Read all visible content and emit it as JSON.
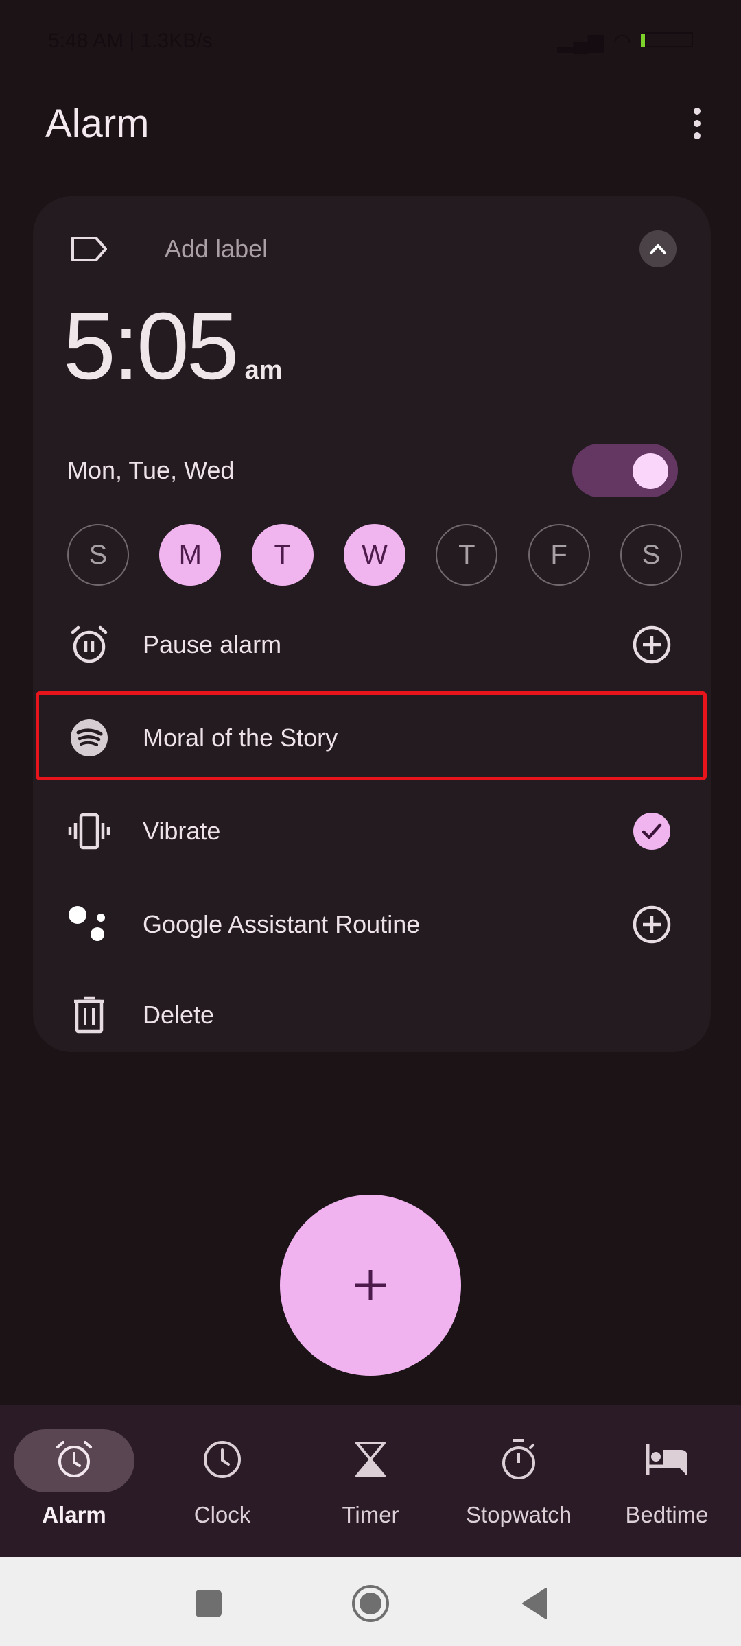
{
  "status_bar": {
    "time": "5:48 AM | 1.3KB/s"
  },
  "header": {
    "title": "Alarm",
    "more_icon": "more-vert-icon"
  },
  "alarm_card": {
    "label_placeholder": "Add label",
    "label_icon": "label-icon",
    "collapse_icon": "chevron-up-icon",
    "time": "5:05",
    "ampm": "am",
    "repeat_summary": "Mon, Tue, Wed",
    "enabled": true,
    "days": [
      {
        "letter": "S",
        "selected": false
      },
      {
        "letter": "M",
        "selected": true
      },
      {
        "letter": "T",
        "selected": true
      },
      {
        "letter": "W",
        "selected": true
      },
      {
        "letter": "T",
        "selected": false
      },
      {
        "letter": "F",
        "selected": false
      },
      {
        "letter": "S",
        "selected": false
      }
    ],
    "options": [
      {
        "label": "Pause alarm",
        "icon": "alarm-pause-icon",
        "action": "add-circle-icon"
      },
      {
        "label": "Moral of the Story",
        "icon": "spotify-icon",
        "action": null,
        "highlighted": true
      },
      {
        "label": "Vibrate",
        "icon": "vibrate-icon",
        "action": "check-circle-icon",
        "checked": true
      },
      {
        "label": "Google Assistant Routine",
        "icon": "google-assistant-icon",
        "action": "add-circle-icon"
      },
      {
        "label": "Delete",
        "icon": "trash-icon",
        "action": null
      }
    ]
  },
  "fab": {
    "icon": "plus-icon"
  },
  "bottom_nav": {
    "active": "Alarm",
    "items": [
      {
        "label": "Alarm",
        "icon": "alarm-icon"
      },
      {
        "label": "Clock",
        "icon": "clock-icon"
      },
      {
        "label": "Timer",
        "icon": "hourglass-icon"
      },
      {
        "label": "Stopwatch",
        "icon": "stopwatch-icon"
      },
      {
        "label": "Bedtime",
        "icon": "bed-icon"
      }
    ]
  },
  "system_nav": {
    "buttons": [
      "recents",
      "home",
      "back"
    ]
  },
  "colors": {
    "background": "#1c1317",
    "card": "#241b21",
    "accent": "#f0b5ee",
    "toggle_track": "#643763",
    "highlight": "#e8141c",
    "nav_bar": "#2a1b27"
  }
}
